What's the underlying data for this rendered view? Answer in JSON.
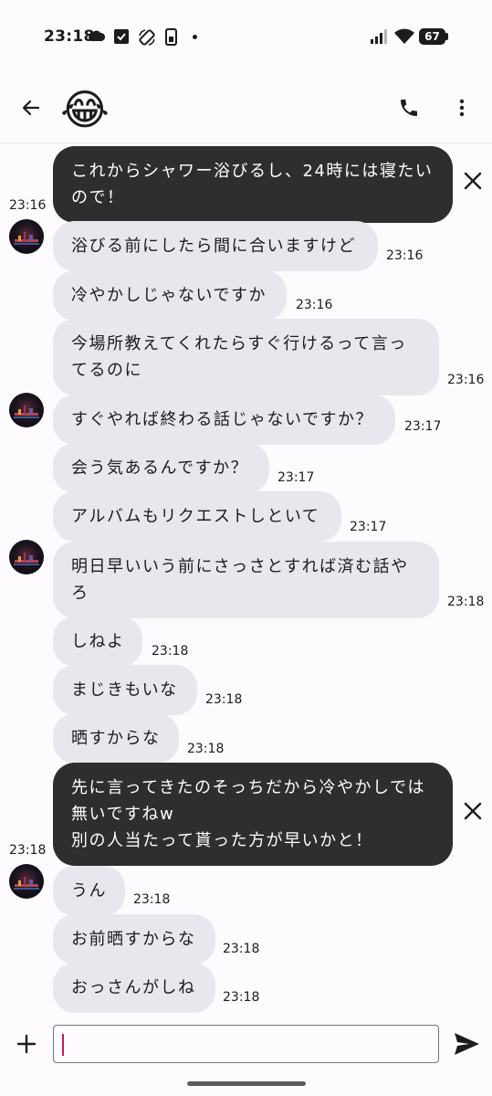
{
  "status_bar": {
    "time": "23:18",
    "battery": "67",
    "icons": [
      "weather-icon",
      "check-box-icon",
      "rotation-icon",
      "phone-icon",
      "signal-icon",
      "wifi-icon",
      "battery-icon"
    ]
  },
  "app_bar": {
    "back_icon": "arrow-left-icon",
    "contact_emoji": "😂",
    "call_icon": "phone-icon",
    "menu_icon": "more-vertical-icon"
  },
  "messages": [
    {
      "dir": "out",
      "lines": [
        "これからシャワー浴びるし、24時には寝たい",
        "ので！"
      ],
      "time": "23:16"
    },
    {
      "dir": "in",
      "avatar": true,
      "lines": [
        "浴びる前にしたら間に合いますけど"
      ],
      "time": "23:16"
    },
    {
      "dir": "in",
      "lines": [
        "冷やかしじゃないですか"
      ],
      "time": "23:16"
    },
    {
      "dir": "in",
      "lines": [
        "今場所教えてくれたらすぐ行けるって言っ",
        "てるのに"
      ],
      "time": "23:16"
    },
    {
      "dir": "in",
      "avatar": true,
      "lines": [
        "すぐやれば終わる話じゃないですか？"
      ],
      "time": "23:17"
    },
    {
      "dir": "in",
      "lines": [
        "会う気あるんですか？"
      ],
      "time": "23:17"
    },
    {
      "dir": "in",
      "lines": [
        "アルバムもリクエストしといて"
      ],
      "time": "23:17"
    },
    {
      "dir": "in",
      "avatar": true,
      "lines": [
        "明日早いいう前にさっさとすれば済む話や",
        "ろ"
      ],
      "time": "23:18"
    },
    {
      "dir": "in",
      "lines": [
        "しねよ"
      ],
      "time": "23:18"
    },
    {
      "dir": "in",
      "lines": [
        "まじきもいな"
      ],
      "time": "23:18"
    },
    {
      "dir": "in",
      "lines": [
        "晒すからな"
      ],
      "time": "23:18"
    },
    {
      "dir": "out",
      "lines": [
        "先に言ってきたのそっちだから冷やかしでは",
        "無いですねw",
        "別の人当たって貰った方が早いかと！"
      ],
      "time": "23:18"
    },
    {
      "dir": "in",
      "avatar": true,
      "lines": [
        "うん"
      ],
      "time": "23:18"
    },
    {
      "dir": "in",
      "lines": [
        "お前晒すからな"
      ],
      "time": "23:18"
    },
    {
      "dir": "in",
      "lines": [
        "おっさんがしね"
      ],
      "time": "23:18"
    }
  ],
  "composer": {
    "value": "",
    "placeholder": "",
    "add_icon": "plus-icon",
    "send_icon": "send-icon"
  },
  "colors": {
    "background": "#fdfbfd",
    "incoming_bubble": "#e9e6ee",
    "outgoing_bubble": "#302d2e",
    "caret": "#c2185b"
  }
}
